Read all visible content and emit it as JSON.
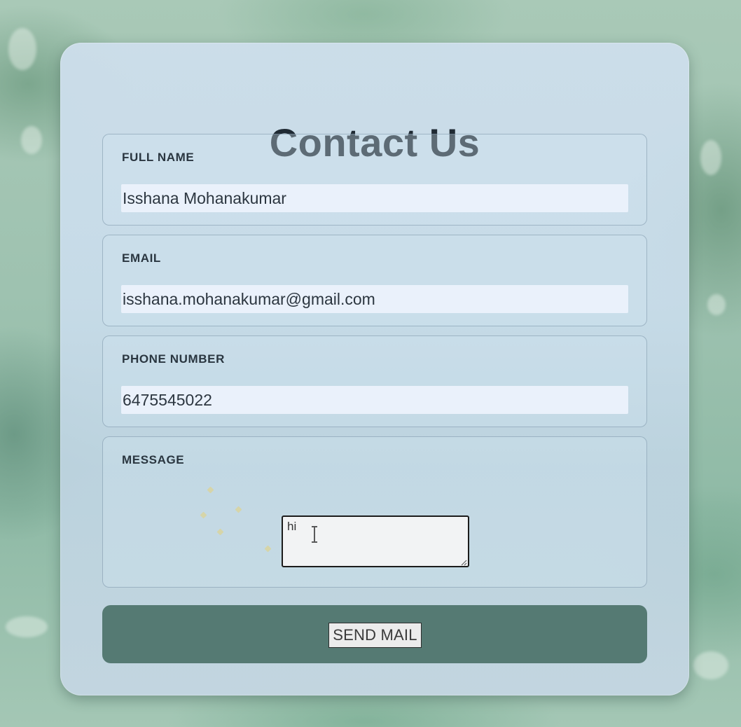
{
  "form": {
    "title": "Contact Us",
    "fields": [
      {
        "label": "FULL NAME",
        "value": "Isshana Mohanakumar"
      },
      {
        "label": "EMAIL",
        "value": "isshana.mohanakumar@gmail.com"
      },
      {
        "label": "PHONE NUMBER",
        "value": "6475545022"
      }
    ],
    "message": {
      "label": "MESSAGE",
      "value": "hi"
    },
    "submit_label": "SEND MAIL"
  },
  "colors": {
    "card_background": "#c8dceb",
    "send_bar": "#557a73",
    "title_text": "#1f2a33",
    "input_background": "#eaf1fb"
  },
  "icons": {
    "cursor": "text-cursor-icon",
    "textarea_grip": "resize-grip-icon"
  }
}
